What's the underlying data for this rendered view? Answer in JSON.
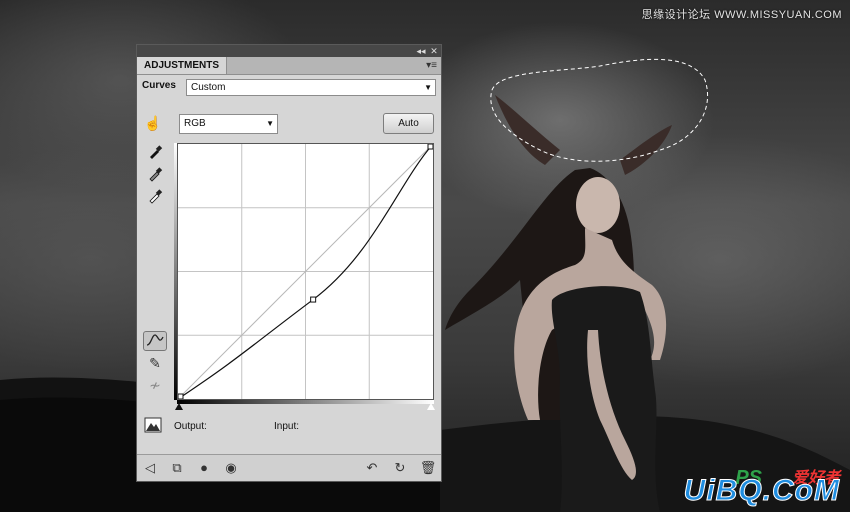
{
  "watermark": {
    "top_text": "思缘设计论坛 WWW.MISSYUAN.COM",
    "logo_ps": "PS",
    "logo_cn": "爱好者",
    "site": "UiBQ.CoM"
  },
  "panel": {
    "tab_label": "ADJUSTMENTS",
    "title": "Curves",
    "preset_value": "Custom",
    "channel_value": "RGB",
    "auto_label": "Auto",
    "output_label": "Output:",
    "input_label": "Input:"
  },
  "icons": {
    "collapse": "collapse-icon",
    "close": "close-icon",
    "menu": "panel-menu-icon",
    "hand": "on-image-adjust-icon",
    "eyedropper_black": "eyedropper-black-icon",
    "eyedropper_gray": "eyedropper-gray-icon",
    "eyedropper_white": "eyedropper-white-icon",
    "curve_tool": "curve-points-icon",
    "pencil": "pencil-icon",
    "smooth": "smooth-icon",
    "clipping": "clipping-warning-icon",
    "back": "back-arrow-icon",
    "expanded": "expanded-view-icon",
    "clip": "clip-to-layer-icon",
    "visibility": "eye-icon",
    "previous": "view-previous-icon",
    "reset": "reset-icon",
    "trash": "trash-icon"
  },
  "colors": {
    "panel_bg": "#d6d6d6",
    "titlebar": "#474747",
    "curve": "#111111"
  },
  "curve": {
    "grid_divisions": 4,
    "points": [
      [
        0,
        0
      ],
      [
        0.53,
        0.39
      ],
      [
        1,
        1
      ]
    ]
  }
}
